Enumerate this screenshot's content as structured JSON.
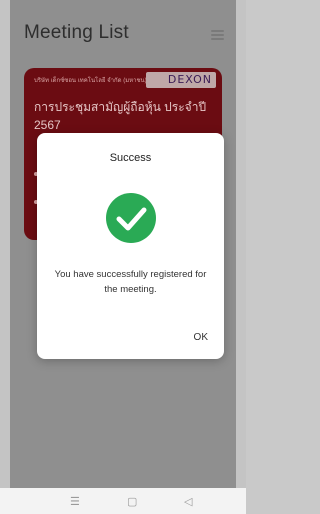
{
  "header": {
    "title": "Meeting List",
    "menu_icon": "hamburger-menu-icon"
  },
  "meeting_card": {
    "company": "บริษัท เด็กซ์ซอน เทคโนโลยี จำกัด (มหาชน)",
    "logo_text": "DEXON",
    "title": "การประชุมสามัญผู้ถือหุ้น ประจำปี 2567",
    "background_color": "#8a0f18"
  },
  "dialog": {
    "title": "Success",
    "icon": "check-circle-icon",
    "message": "You have successfully registered for the meeting.",
    "ok_label": "OK",
    "accent_color": "#2aaa55"
  },
  "nav_bar": {
    "recent_icon": "recent-apps-icon",
    "home_icon": "home-icon",
    "back_icon": "back-icon"
  }
}
